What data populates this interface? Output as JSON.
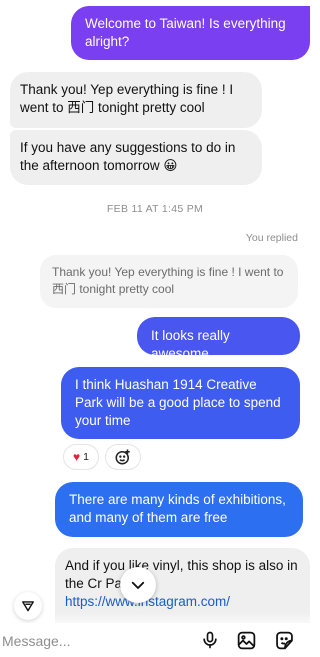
{
  "messages": {
    "m1": "Welcome to Taiwan! Is everything alright?",
    "m2": "Thank you! Yep everything is fine ! I went to 西门 tonight pretty cool",
    "m3": "If you have any suggestions to do in the afternoon tomorrow 😀",
    "timestamp": "FEB 11 AT 1:45 PM",
    "replied_label": "You replied",
    "quoted": "Thank you! Yep everything is fine ! I went to 西门 tonight pretty cool",
    "m4": "It looks really awesome",
    "m5": "I think Huashan 1914 Creative Park will be a good place to spend your time",
    "reaction_count": "1",
    "m6": "There are many kinds of exhibitions, and many of them are free",
    "m7_part1": "And if you",
    "m7_part2": " like vinyl, this shop is also in the Cr",
    "m7_part3": " Park",
    "m7_link": "https://www.instagram.com/"
  },
  "composer": {
    "placeholder": "Message..."
  },
  "colors": {
    "bubble_purple": "#7a3ff0",
    "bubble_indigo": "#4a56f0",
    "bubble_blue": "#3f5cf0",
    "bubble_bright_blue": "#2c6ff0",
    "incoming_gray": "#efefef"
  },
  "icons": [
    "collapse-icon",
    "chevron-down-icon",
    "heart-icon",
    "add-reaction-icon",
    "microphone-icon",
    "gallery-icon",
    "sticker-icon"
  ]
}
